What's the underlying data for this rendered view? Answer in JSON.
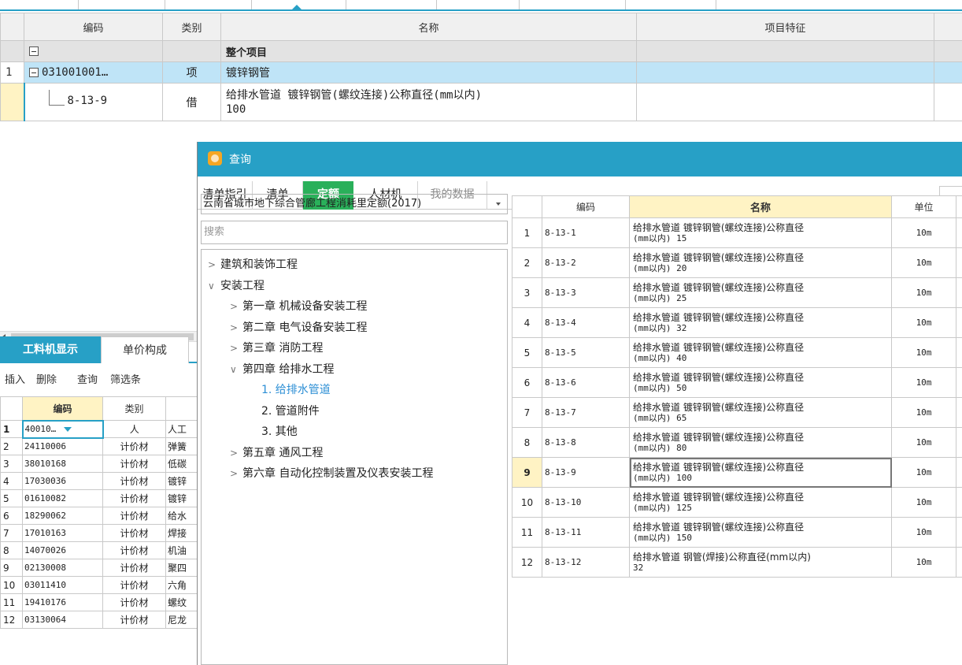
{
  "upper_grid": {
    "headers": {
      "code": "编码",
      "type": "类别",
      "name": "名称",
      "feature": "项目特征"
    },
    "project_row": {
      "name": "整个项目"
    },
    "selected_row": {
      "index": "1",
      "code": "031001001…",
      "type": "项",
      "name": "镀锌钢管"
    },
    "sub_row": {
      "code": "8-13-9",
      "type": "借",
      "name_line1": "给排水管道 镀锌钢管(螺纹连接)公称直径(mm以内)",
      "name_line2": "100"
    }
  },
  "bottom_left": {
    "tabs": {
      "active": "工料机显示",
      "other": "单价构成"
    },
    "toolbar": {
      "insert": "插入",
      "delete": "删除",
      "query": "查询",
      "filter": "筛选条"
    },
    "headers": {
      "code": "编码",
      "type": "类别"
    },
    "rows": [
      {
        "idx": "1",
        "code": "40010…",
        "type": "人",
        "name": "人工"
      },
      {
        "idx": "2",
        "code": "24110006",
        "type": "计价材",
        "name": "弹簧"
      },
      {
        "idx": "3",
        "code": "38010168",
        "type": "计价材",
        "name": "低碳"
      },
      {
        "idx": "4",
        "code": "17030036",
        "type": "计价材",
        "name": "镀锌"
      },
      {
        "idx": "5",
        "code": "01610082",
        "type": "计价材",
        "name": "镀锌"
      },
      {
        "idx": "6",
        "code": "18290062",
        "type": "计价材",
        "name": "给水"
      },
      {
        "idx": "7",
        "code": "17010163",
        "type": "计价材",
        "name": "焊接"
      },
      {
        "idx": "8",
        "code": "14070026",
        "type": "计价材",
        "name": "机油"
      },
      {
        "idx": "9",
        "code": "02130008",
        "type": "计价材",
        "name": "聚四"
      },
      {
        "idx": "10",
        "code": "03011410",
        "type": "计价材",
        "name": "六角"
      },
      {
        "idx": "11",
        "code": "19410176",
        "type": "计价材",
        "name": "螺纹"
      },
      {
        "idx": "12",
        "code": "03130064",
        "type": "计价材",
        "name": "尼龙"
      }
    ]
  },
  "dialog": {
    "title": "查询",
    "tabs": [
      "清单指引",
      "清单",
      "定额",
      "人材机",
      "我的数据"
    ],
    "quota_select": "云南省城市地下综合管廊工程消耗里定额(2017)",
    "search_placeholder": "搜索",
    "tree": [
      {
        "label": "建筑和装饰工程",
        "level": 0,
        "expanded": false
      },
      {
        "label": "安装工程",
        "level": 0,
        "expanded": true
      },
      {
        "label": "第一章 机械设备安装工程",
        "level": 1,
        "expanded": false
      },
      {
        "label": "第二章 电气设备安装工程",
        "level": 1,
        "expanded": false
      },
      {
        "label": "第三章 消防工程",
        "level": 1,
        "expanded": false
      },
      {
        "label": "第四章 给排水工程",
        "level": 1,
        "expanded": true
      },
      {
        "label": "1. 给排水管道",
        "level": 2,
        "selected": true
      },
      {
        "label": "2. 管道附件",
        "level": 2
      },
      {
        "label": "3. 其他",
        "level": 2
      },
      {
        "label": "第五章 通风工程",
        "level": 1,
        "expanded": false
      },
      {
        "label": "第六章 自动化控制装置及仪表安装工程",
        "level": 1,
        "expanded": false
      }
    ],
    "table_headers": {
      "code": "编码",
      "name": "名称",
      "unit": "单位"
    },
    "rows": [
      {
        "idx": "1",
        "code": "8-13-1",
        "name1": "给排水管道 镀锌钢管(螺纹连接)公称直径",
        "name2": "(mm以内) 15",
        "unit": "10m"
      },
      {
        "idx": "2",
        "code": "8-13-2",
        "name1": "给排水管道 镀锌钢管(螺纹连接)公称直径",
        "name2": "(mm以内) 20",
        "unit": "10m"
      },
      {
        "idx": "3",
        "code": "8-13-3",
        "name1": "给排水管道 镀锌钢管(螺纹连接)公称直径",
        "name2": "(mm以内) 25",
        "unit": "10m"
      },
      {
        "idx": "4",
        "code": "8-13-4",
        "name1": "给排水管道 镀锌钢管(螺纹连接)公称直径",
        "name2": "(mm以内) 32",
        "unit": "10m"
      },
      {
        "idx": "5",
        "code": "8-13-5",
        "name1": "给排水管道 镀锌钢管(螺纹连接)公称直径",
        "name2": "(mm以内) 40",
        "unit": "10m"
      },
      {
        "idx": "6",
        "code": "8-13-6",
        "name1": "给排水管道 镀锌钢管(螺纹连接)公称直径",
        "name2": "(mm以内) 50",
        "unit": "10m"
      },
      {
        "idx": "7",
        "code": "8-13-7",
        "name1": "给排水管道 镀锌钢管(螺纹连接)公称直径",
        "name2": "(mm以内) 65",
        "unit": "10m"
      },
      {
        "idx": "8",
        "code": "8-13-8",
        "name1": "给排水管道 镀锌钢管(螺纹连接)公称直径",
        "name2": "(mm以内) 80",
        "unit": "10m"
      },
      {
        "idx": "9",
        "code": "8-13-9",
        "name1": "给排水管道 镀锌钢管(螺纹连接)公称直径",
        "name2": "(mm以内) 100",
        "unit": "10m",
        "selected": true
      },
      {
        "idx": "10",
        "code": "8-13-10",
        "name1": "给排水管道 镀锌钢管(螺纹连接)公称直径",
        "name2": "(mm以内) 125",
        "unit": "10m"
      },
      {
        "idx": "11",
        "code": "8-13-11",
        "name1": "给排水管道 镀锌钢管(螺纹连接)公称直径",
        "name2": "(mm以内) 150",
        "unit": "10m"
      },
      {
        "idx": "12",
        "code": "8-13-12",
        "name1": "给排水管道 钢管(焊接)公称直径(mm以内)",
        "name2": "32",
        "unit": "10m"
      }
    ]
  }
}
